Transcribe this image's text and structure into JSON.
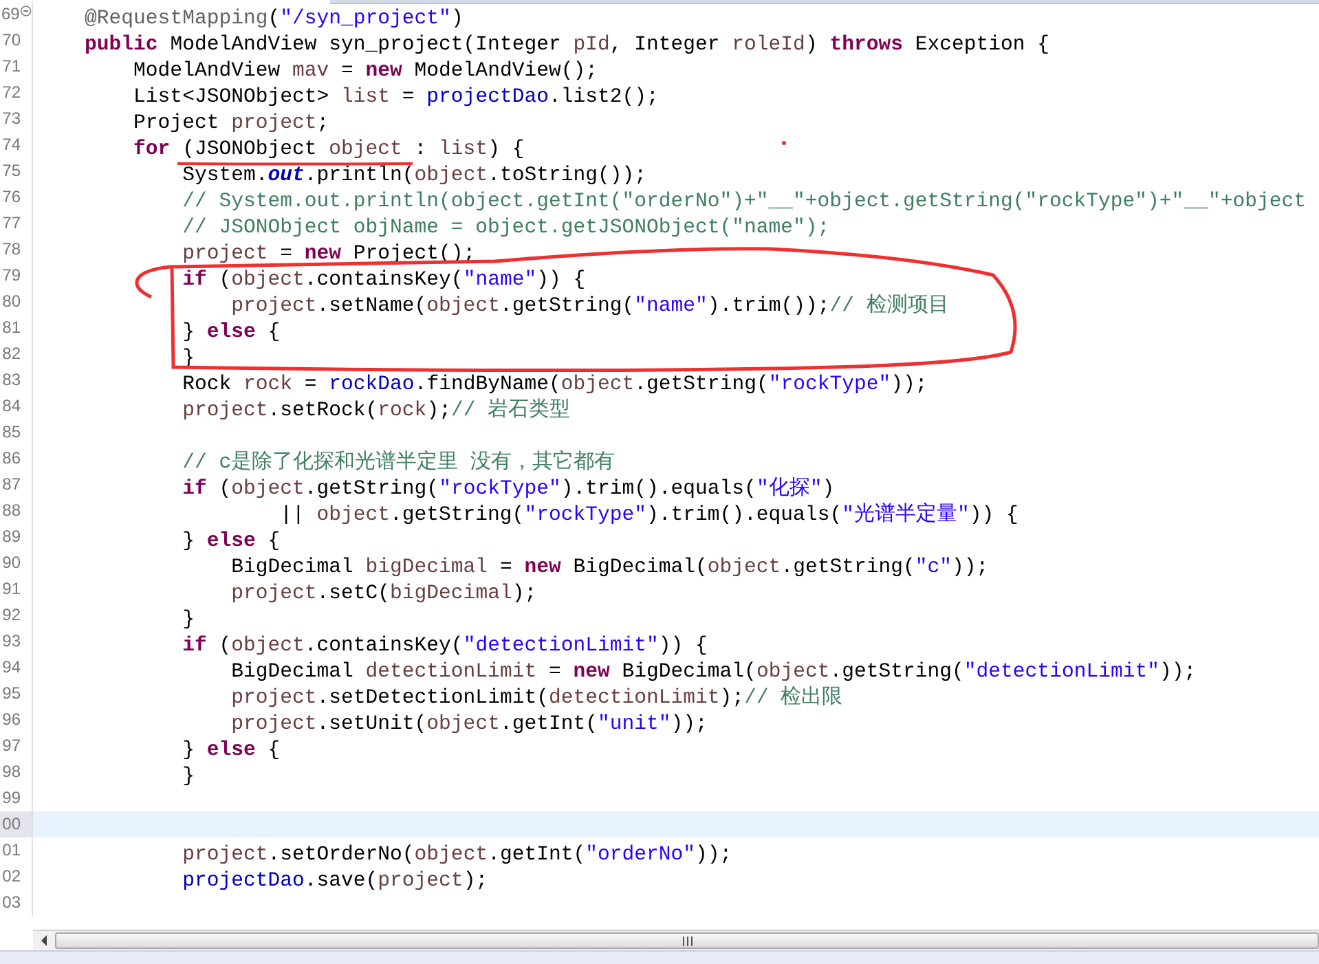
{
  "editor": {
    "lines": [
      {
        "number": "69",
        "current": false,
        "fold": true,
        "tokens": [
          {
            "kind": "ann",
            "text": "\t@RequestMapping"
          },
          {
            "kind": "plain",
            "text": "("
          },
          {
            "kind": "str",
            "text": "\"/syn_project\""
          },
          {
            "kind": "plain",
            "text": ")"
          }
        ]
      },
      {
        "number": "70",
        "current": false,
        "fold": false,
        "tokens": [
          {
            "kind": "kw",
            "text": "\tpublic"
          },
          {
            "kind": "plain",
            "text": " ModelAndView syn_project(Integer "
          },
          {
            "kind": "var",
            "text": "pId"
          },
          {
            "kind": "plain",
            "text": ", Integer "
          },
          {
            "kind": "var",
            "text": "roleId"
          },
          {
            "kind": "plain",
            "text": ") "
          },
          {
            "kind": "kw",
            "text": "throws"
          },
          {
            "kind": "plain",
            "text": " Exception {"
          }
        ]
      },
      {
        "number": "71",
        "current": false,
        "fold": false,
        "tokens": [
          {
            "kind": "plain",
            "text": "\t\tModelAndView "
          },
          {
            "kind": "var",
            "text": "mav"
          },
          {
            "kind": "plain",
            "text": " = "
          },
          {
            "kind": "kw",
            "text": "new"
          },
          {
            "kind": "plain",
            "text": " ModelAndView();"
          }
        ]
      },
      {
        "number": "72",
        "current": false,
        "fold": false,
        "tokens": [
          {
            "kind": "plain",
            "text": "\t\tList<JSONObject> "
          },
          {
            "kind": "var",
            "text": "list"
          },
          {
            "kind": "plain",
            "text": " = "
          },
          {
            "kind": "field",
            "text": "projectDao"
          },
          {
            "kind": "plain",
            "text": ".list2();"
          }
        ]
      },
      {
        "number": "73",
        "current": false,
        "fold": false,
        "tokens": [
          {
            "kind": "plain",
            "text": "\t\tProject "
          },
          {
            "kind": "var",
            "text": "project"
          },
          {
            "kind": "plain",
            "text": ";"
          }
        ]
      },
      {
        "number": "74",
        "current": false,
        "fold": false,
        "tokens": [
          {
            "kind": "kw",
            "text": "\t\tfor"
          },
          {
            "kind": "plain",
            "text": " (JSONObject "
          },
          {
            "kind": "var",
            "text": "object"
          },
          {
            "kind": "plain",
            "text": " : "
          },
          {
            "kind": "var",
            "text": "list"
          },
          {
            "kind": "plain",
            "text": ") {"
          }
        ]
      },
      {
        "number": "75",
        "current": false,
        "fold": false,
        "tokens": [
          {
            "kind": "plain",
            "text": "\t\t\tSystem."
          },
          {
            "kind": "static",
            "text": "out"
          },
          {
            "kind": "plain",
            "text": ".println("
          },
          {
            "kind": "var",
            "text": "object"
          },
          {
            "kind": "plain",
            "text": ".toString());"
          }
        ]
      },
      {
        "number": "76",
        "current": false,
        "fold": false,
        "tokens": [
          {
            "kind": "cmt",
            "text": "\t\t\t// System.out.println(object.getInt(\"orderNo\")+\"__\"+object.getString(\"rockType\")+\"__\"+object"
          }
        ]
      },
      {
        "number": "77",
        "current": false,
        "fold": false,
        "tokens": [
          {
            "kind": "cmt",
            "text": "\t\t\t// JSONObject objName = object.getJSONObject(\"name\");"
          }
        ]
      },
      {
        "number": "78",
        "current": false,
        "fold": false,
        "tokens": [
          {
            "kind": "var",
            "text": "\t\t\tproject"
          },
          {
            "kind": "plain",
            "text": " = "
          },
          {
            "kind": "kw",
            "text": "new"
          },
          {
            "kind": "plain",
            "text": " Project();"
          }
        ]
      },
      {
        "number": "79",
        "current": false,
        "fold": false,
        "tokens": [
          {
            "kind": "kw",
            "text": "\t\t\tif"
          },
          {
            "kind": "plain",
            "text": " ("
          },
          {
            "kind": "var",
            "text": "object"
          },
          {
            "kind": "plain",
            "text": ".containsKey("
          },
          {
            "kind": "str",
            "text": "\"name\""
          },
          {
            "kind": "plain",
            "text": ")) {"
          }
        ]
      },
      {
        "number": "80",
        "current": false,
        "fold": false,
        "tokens": [
          {
            "kind": "var",
            "text": "\t\t\t\tproject"
          },
          {
            "kind": "plain",
            "text": ".setName("
          },
          {
            "kind": "var",
            "text": "object"
          },
          {
            "kind": "plain",
            "text": ".getString("
          },
          {
            "kind": "str",
            "text": "\"name\""
          },
          {
            "kind": "plain",
            "text": ").trim());"
          },
          {
            "kind": "cmt",
            "text": "// 检测项目"
          }
        ]
      },
      {
        "number": "81",
        "current": false,
        "fold": false,
        "tokens": [
          {
            "kind": "plain",
            "text": "\t\t\t} "
          },
          {
            "kind": "kw",
            "text": "else"
          },
          {
            "kind": "plain",
            "text": " {"
          }
        ]
      },
      {
        "number": "82",
        "current": false,
        "fold": false,
        "tokens": [
          {
            "kind": "plain",
            "text": "\t\t\t}"
          }
        ]
      },
      {
        "number": "83",
        "current": false,
        "fold": false,
        "tokens": [
          {
            "kind": "plain",
            "text": "\t\t\tRock "
          },
          {
            "kind": "var",
            "text": "rock"
          },
          {
            "kind": "plain",
            "text": " = "
          },
          {
            "kind": "field",
            "text": "rockDao"
          },
          {
            "kind": "plain",
            "text": ".findByName("
          },
          {
            "kind": "var",
            "text": "object"
          },
          {
            "kind": "plain",
            "text": ".getString("
          },
          {
            "kind": "str",
            "text": "\"rockType\""
          },
          {
            "kind": "plain",
            "text": "));"
          }
        ]
      },
      {
        "number": "84",
        "current": false,
        "fold": false,
        "tokens": [
          {
            "kind": "var",
            "text": "\t\t\tproject"
          },
          {
            "kind": "plain",
            "text": ".setRock("
          },
          {
            "kind": "var",
            "text": "rock"
          },
          {
            "kind": "plain",
            "text": ");"
          },
          {
            "kind": "cmt",
            "text": "// 岩石类型"
          }
        ]
      },
      {
        "number": "85",
        "current": false,
        "fold": false
      },
      {
        "number": "86",
        "current": false,
        "fold": false,
        "tokens": [
          {
            "kind": "cmt",
            "text": "\t\t\t// c是除了化探和光谱半定里 没有，其它都有"
          }
        ]
      },
      {
        "number": "87",
        "current": false,
        "fold": false,
        "tokens": [
          {
            "kind": "kw",
            "text": "\t\t\tif"
          },
          {
            "kind": "plain",
            "text": " ("
          },
          {
            "kind": "var",
            "text": "object"
          },
          {
            "kind": "plain",
            "text": ".getString("
          },
          {
            "kind": "str",
            "text": "\"rockType\""
          },
          {
            "kind": "plain",
            "text": ").trim().equals("
          },
          {
            "kind": "str",
            "text": "\"化探\""
          },
          {
            "kind": "plain",
            "text": ")"
          }
        ]
      },
      {
        "number": "88",
        "current": false,
        "fold": false,
        "tokens": [
          {
            "kind": "plain",
            "text": "\t\t\t\t\t|| "
          },
          {
            "kind": "var",
            "text": "object"
          },
          {
            "kind": "plain",
            "text": ".getString("
          },
          {
            "kind": "str",
            "text": "\"rockType\""
          },
          {
            "kind": "plain",
            "text": ").trim().equals("
          },
          {
            "kind": "str",
            "text": "\"光谱半定量\""
          },
          {
            "kind": "plain",
            "text": ")) {"
          }
        ]
      },
      {
        "number": "89",
        "current": false,
        "fold": false,
        "tokens": [
          {
            "kind": "plain",
            "text": "\t\t\t} "
          },
          {
            "kind": "kw",
            "text": "else"
          },
          {
            "kind": "plain",
            "text": " {"
          }
        ]
      },
      {
        "number": "90",
        "current": false,
        "fold": false,
        "tokens": [
          {
            "kind": "plain",
            "text": "\t\t\t\tBigDecimal "
          },
          {
            "kind": "var",
            "text": "bigDecimal"
          },
          {
            "kind": "plain",
            "text": " = "
          },
          {
            "kind": "kw",
            "text": "new"
          },
          {
            "kind": "plain",
            "text": " BigDecimal("
          },
          {
            "kind": "var",
            "text": "object"
          },
          {
            "kind": "plain",
            "text": ".getString("
          },
          {
            "kind": "str",
            "text": "\"c\""
          },
          {
            "kind": "plain",
            "text": "));"
          }
        ]
      },
      {
        "number": "91",
        "current": false,
        "fold": false,
        "tokens": [
          {
            "kind": "var",
            "text": "\t\t\t\tproject"
          },
          {
            "kind": "plain",
            "text": ".setC("
          },
          {
            "kind": "var",
            "text": "bigDecimal"
          },
          {
            "kind": "plain",
            "text": ");"
          }
        ]
      },
      {
        "number": "92",
        "current": false,
        "fold": false,
        "tokens": [
          {
            "kind": "plain",
            "text": "\t\t\t}"
          }
        ]
      },
      {
        "number": "93",
        "current": false,
        "fold": false,
        "tokens": [
          {
            "kind": "kw",
            "text": "\t\t\tif"
          },
          {
            "kind": "plain",
            "text": " ("
          },
          {
            "kind": "var",
            "text": "object"
          },
          {
            "kind": "plain",
            "text": ".containsKey("
          },
          {
            "kind": "str",
            "text": "\"detectionLimit\""
          },
          {
            "kind": "plain",
            "text": ")) {"
          }
        ]
      },
      {
        "number": "94",
        "current": false,
        "fold": false,
        "tokens": [
          {
            "kind": "plain",
            "text": "\t\t\t\tBigDecimal "
          },
          {
            "kind": "var",
            "text": "detectionLimit"
          },
          {
            "kind": "plain",
            "text": " = "
          },
          {
            "kind": "kw",
            "text": "new"
          },
          {
            "kind": "plain",
            "text": " BigDecimal("
          },
          {
            "kind": "var",
            "text": "object"
          },
          {
            "kind": "plain",
            "text": ".getString("
          },
          {
            "kind": "str",
            "text": "\"detectionLimit\""
          },
          {
            "kind": "plain",
            "text": "));"
          }
        ]
      },
      {
        "number": "95",
        "current": false,
        "fold": false,
        "tokens": [
          {
            "kind": "var",
            "text": "\t\t\t\tproject"
          },
          {
            "kind": "plain",
            "text": ".setDetectionLimit("
          },
          {
            "kind": "var",
            "text": "detectionLimit"
          },
          {
            "kind": "plain",
            "text": ");"
          },
          {
            "kind": "cmt",
            "text": "// 检出限"
          }
        ]
      },
      {
        "number": "96",
        "current": false,
        "fold": false,
        "tokens": [
          {
            "kind": "var",
            "text": "\t\t\t\tproject"
          },
          {
            "kind": "plain",
            "text": ".setUnit("
          },
          {
            "kind": "var",
            "text": "object"
          },
          {
            "kind": "plain",
            "text": ".getInt("
          },
          {
            "kind": "str",
            "text": "\"unit\""
          },
          {
            "kind": "plain",
            "text": "));"
          }
        ]
      },
      {
        "number": "97",
        "current": false,
        "fold": false,
        "tokens": [
          {
            "kind": "plain",
            "text": "\t\t\t} "
          },
          {
            "kind": "kw",
            "text": "else"
          },
          {
            "kind": "plain",
            "text": " {"
          }
        ]
      },
      {
        "number": "98",
        "current": false,
        "fold": false,
        "tokens": [
          {
            "kind": "plain",
            "text": "\t\t\t}"
          }
        ]
      },
      {
        "number": "99",
        "current": false,
        "fold": false
      },
      {
        "number": "00",
        "current": true,
        "fold": false
      },
      {
        "number": "01",
        "current": false,
        "fold": false,
        "tokens": [
          {
            "kind": "var",
            "text": "\t\t\tproject"
          },
          {
            "kind": "plain",
            "text": ".setOrderNo("
          },
          {
            "kind": "var",
            "text": "object"
          },
          {
            "kind": "plain",
            "text": ".getInt("
          },
          {
            "kind": "str",
            "text": "\"orderNo\""
          },
          {
            "kind": "plain",
            "text": "));"
          }
        ]
      },
      {
        "number": "02",
        "current": false,
        "fold": false,
        "tokens": [
          {
            "kind": "field",
            "text": "\t\t\tprojectDao"
          },
          {
            "kind": "plain",
            "text": ".save("
          },
          {
            "kind": "var",
            "text": "project"
          },
          {
            "kind": "plain",
            "text": ");"
          }
        ]
      },
      {
        "number": "03",
        "current": false,
        "fold": false
      }
    ]
  }
}
